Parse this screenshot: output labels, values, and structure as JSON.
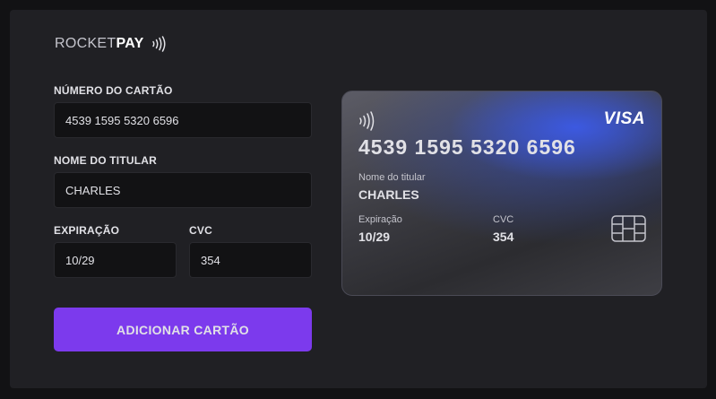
{
  "brand": {
    "prefix": "ROCKET",
    "suffix": "PAY"
  },
  "form": {
    "number_label": "NÚMERO DO CARTÃO",
    "number_value": "4539 1595 5320 6596",
    "holder_label": "NOME DO TITULAR",
    "holder_value": "CHARLES",
    "expiry_label": "EXPIRAÇÃO",
    "expiry_value": "10/29",
    "cvc_label": "CVC",
    "cvc_value": "354",
    "submit_label": "ADICIONAR CARTÃO"
  },
  "card": {
    "brand": "VISA",
    "number": "4539 1595 5320 6596",
    "holder_label": "Nome do titular",
    "holder": "CHARLES",
    "expiry_label": "Expiração",
    "expiry": "10/29",
    "cvc_label": "CVC",
    "cvc": "354"
  },
  "icons": [
    "contactless-icon",
    "card-contactless-icon",
    "chip-icon"
  ],
  "colors": {
    "accent": "#7c3aed",
    "background": "#121214",
    "panel": "#202024",
    "input": "#121214"
  }
}
